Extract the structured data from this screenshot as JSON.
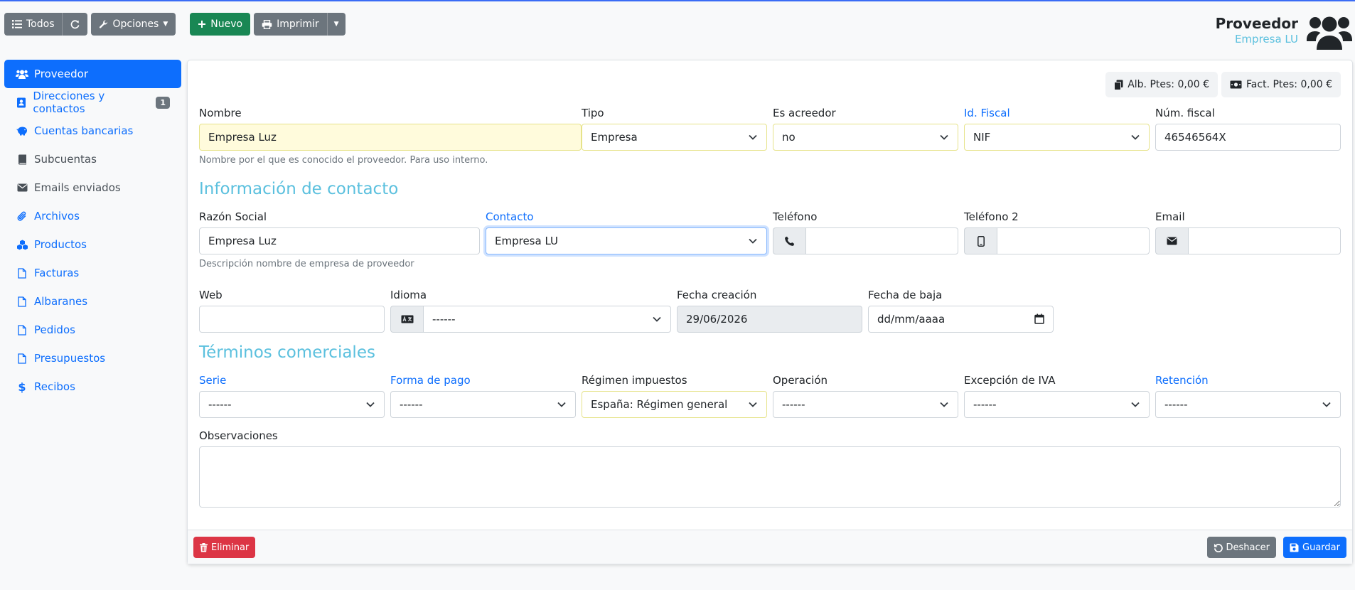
{
  "toolbar": {
    "all_label": "Todos",
    "options_label": "Opciones",
    "new_label": "Nuevo",
    "print_label": "Imprimir"
  },
  "header": {
    "title": "Proveedor",
    "subtitle": "Empresa LU"
  },
  "sidebar": {
    "items": [
      {
        "label": "Proveedor"
      },
      {
        "label": "Direcciones y contactos",
        "badge": "1"
      },
      {
        "label": "Cuentas bancarias"
      },
      {
        "label": "Subcuentas"
      },
      {
        "label": "Emails enviados"
      },
      {
        "label": "Archivos"
      },
      {
        "label": "Productos"
      },
      {
        "label": "Facturas"
      },
      {
        "label": "Albaranes"
      },
      {
        "label": "Pedidos"
      },
      {
        "label": "Presupuestos"
      },
      {
        "label": "Recibos"
      }
    ]
  },
  "stats": {
    "albaranes": "Alb. Ptes: 0,00 €",
    "facturas": "Fact. Ptes: 0,00 €"
  },
  "form": {
    "nombre": {
      "label": "Nombre",
      "value": "Empresa Luz",
      "help": "Nombre por el que es conocido el proveedor. Para uso interno."
    },
    "tipo": {
      "label": "Tipo",
      "value": "Empresa"
    },
    "acreedor": {
      "label": "Es acreedor",
      "value": "no"
    },
    "idfiscal": {
      "label": "Id. Fiscal",
      "value": "NIF"
    },
    "numfiscal": {
      "label": "Núm. fiscal",
      "value": "46546564X"
    },
    "contact_section": "Información de contacto",
    "razon": {
      "label": "Razón Social",
      "value": "Empresa Luz",
      "help": "Descripción nombre de empresa de proveedor"
    },
    "contacto": {
      "label": "Contacto",
      "value": "Empresa LU"
    },
    "telefono": {
      "label": "Teléfono",
      "value": ""
    },
    "telefono2": {
      "label": "Teléfono 2",
      "value": ""
    },
    "email": {
      "label": "Email",
      "value": ""
    },
    "web": {
      "label": "Web",
      "value": ""
    },
    "idioma": {
      "label": "Idioma",
      "value": "------"
    },
    "fechacreacion": {
      "label": "Fecha creación",
      "value": "29/06/2026"
    },
    "fechabaja": {
      "label": "Fecha de baja",
      "placeholder": "dd/mm/aaaa"
    },
    "terms_section": "Términos comerciales",
    "serie": {
      "label": "Serie",
      "value": "------"
    },
    "formapago": {
      "label": "Forma de pago",
      "value": "------"
    },
    "regimen": {
      "label": "Régimen impuestos",
      "value": "España: Régimen general"
    },
    "operacion": {
      "label": "Operación",
      "value": "------"
    },
    "excepcion": {
      "label": "Excepción de IVA",
      "value": "------"
    },
    "retencion": {
      "label": "Retención",
      "value": "------"
    },
    "observaciones": {
      "label": "Observaciones",
      "value": ""
    }
  },
  "footer": {
    "delete_label": "Eliminar",
    "undo_label": "Deshacer",
    "save_label": "Guardar"
  },
  "colors": {
    "primary": "#0d6efd",
    "info": "#5bc0de",
    "success": "#198754",
    "danger": "#dc3545",
    "secondary": "#6c757d"
  }
}
